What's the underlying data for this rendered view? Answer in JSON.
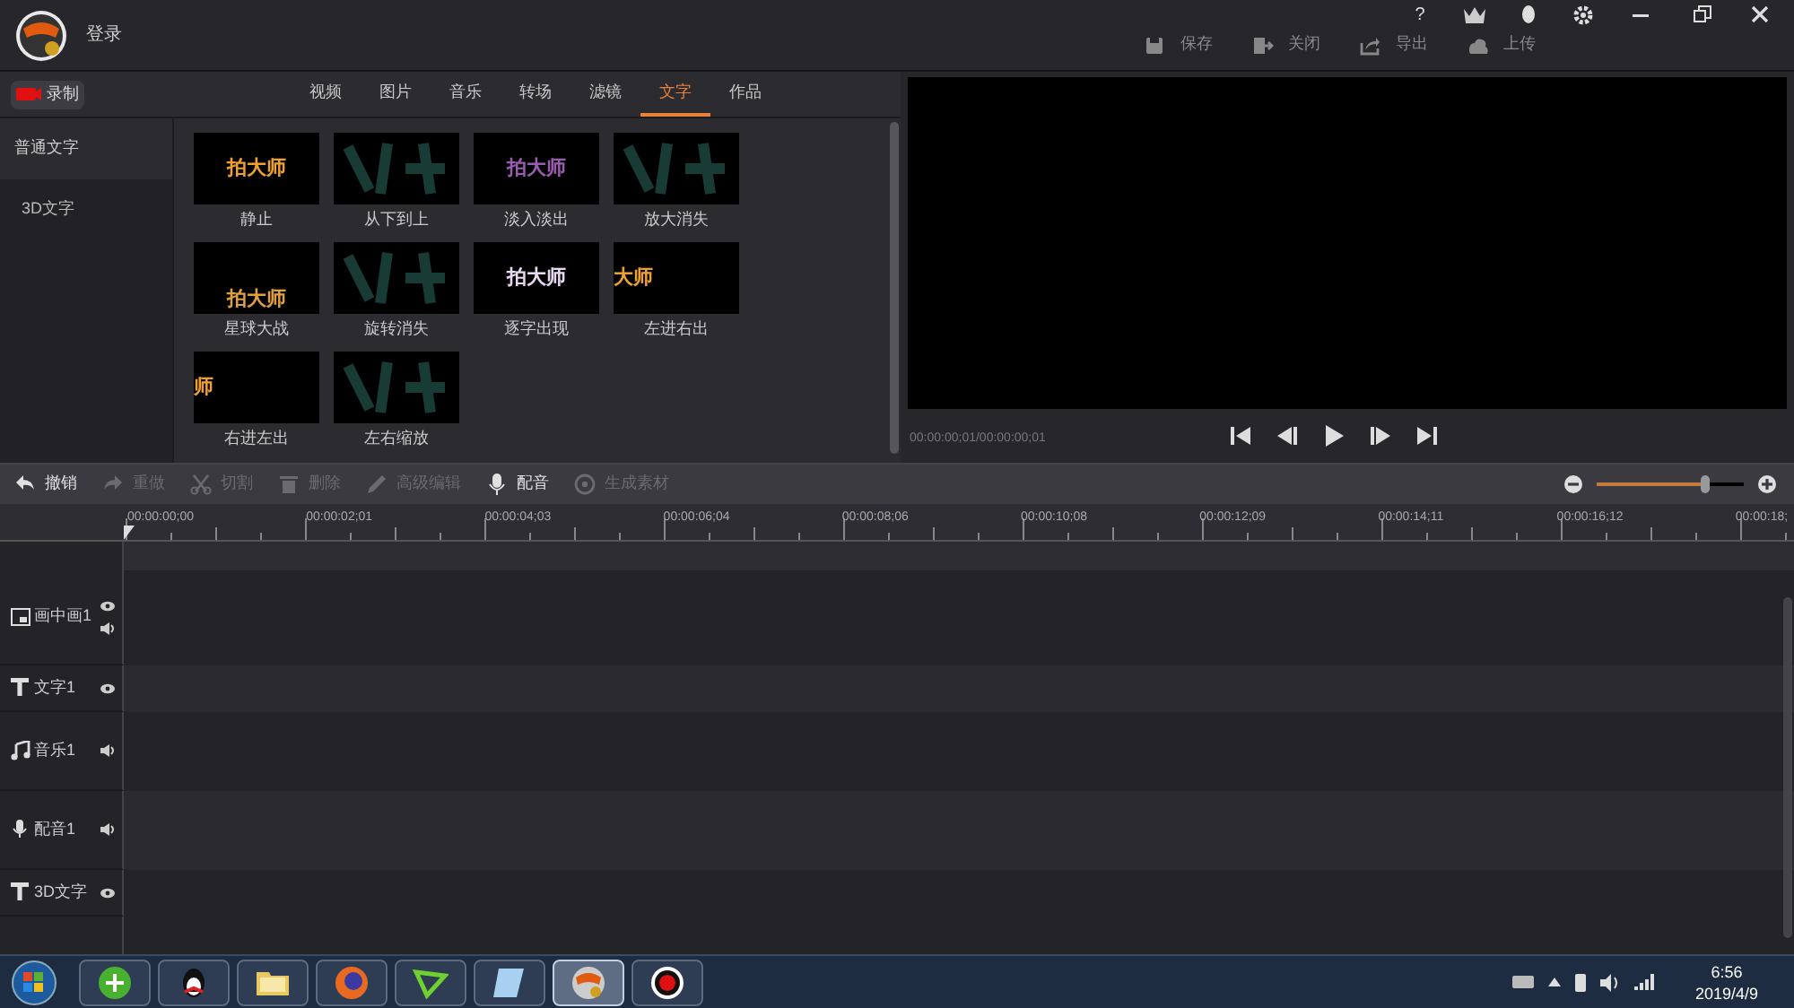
{
  "header": {
    "login": "登录",
    "window_controls": [
      {
        "kind": "help",
        "label": "?"
      },
      {
        "kind": "vip"
      },
      {
        "kind": "qq"
      },
      {
        "kind": "settings"
      },
      {
        "kind": "minimize"
      },
      {
        "kind": "restore"
      },
      {
        "kind": "close"
      }
    ],
    "actions": [
      {
        "kind": "save",
        "label": "保存"
      },
      {
        "kind": "exit",
        "label": "关闭"
      },
      {
        "kind": "export",
        "label": "导出"
      },
      {
        "kind": "upload",
        "label": "上传"
      }
    ]
  },
  "record_button": "录制",
  "tabs": [
    {
      "label": "视频",
      "selected": false
    },
    {
      "label": "图片",
      "selected": false
    },
    {
      "label": "音乐",
      "selected": false
    },
    {
      "label": "转场",
      "selected": false
    },
    {
      "label": "滤镜",
      "selected": false
    },
    {
      "label": "文字",
      "selected": true
    },
    {
      "label": "作品",
      "selected": false
    }
  ],
  "categories": [
    {
      "label": "普通文字",
      "selected": true
    },
    {
      "label": "3D文字",
      "selected": false
    }
  ],
  "effects": [
    {
      "label": "静止",
      "kind": "center",
      "text": "拍大师",
      "color": "#f0a030"
    },
    {
      "label": "从下到上",
      "kind": "abstract"
    },
    {
      "label": "淡入淡出",
      "kind": "center",
      "text": "拍大师",
      "color": "#9a5cb0"
    },
    {
      "label": "放大消失",
      "kind": "abstract"
    },
    {
      "label": "星球大战",
      "kind": "bottom",
      "text": "拍大师",
      "color": "#e0a040"
    },
    {
      "label": "旋转消失",
      "kind": "abstract"
    },
    {
      "label": "逐字出现",
      "kind": "center",
      "text": "拍大师",
      "color": "#e8d8f0"
    },
    {
      "label": "左进右出",
      "kind": "left",
      "text": "大师",
      "color": "#f0a030"
    },
    {
      "label": "右进左出",
      "kind": "left",
      "text": "师",
      "color": "#f0a030"
    },
    {
      "label": "左右缩放",
      "kind": "abstract"
    }
  ],
  "preview": {
    "time": "00:00:00;01/00:00:00;01"
  },
  "edit_toolbar": [
    {
      "kind": "undo",
      "label": "撤销",
      "disabled": false
    },
    {
      "kind": "redo",
      "label": "重做",
      "disabled": true
    },
    {
      "kind": "cut",
      "label": "切割",
      "disabled": true
    },
    {
      "kind": "delete",
      "label": "删除",
      "disabled": true
    },
    {
      "kind": "edit",
      "label": "高级编辑",
      "disabled": true
    },
    {
      "kind": "mic",
      "label": "配音",
      "disabled": false
    },
    {
      "kind": "material",
      "label": "生成素材",
      "disabled": true
    }
  ],
  "zoom": {
    "level": 0.73
  },
  "ruler": [
    "00:00:00;00",
    "00:00:02;01",
    "00:00:04;03",
    "00:00:06;04",
    "00:00:08;06",
    "00:00:10;08",
    "00:00:12;09",
    "00:00:14;11",
    "00:00:16;12",
    "00:00:18;"
  ],
  "tracks": [
    {
      "kind": "pip",
      "label": "画中画1",
      "eye": true,
      "sound": true
    },
    {
      "kind": "text",
      "label": "文字1",
      "eye": true,
      "sound": false
    },
    {
      "kind": "music",
      "label": "音乐1",
      "eye": false,
      "sound": true
    },
    {
      "kind": "voice",
      "label": "配音1",
      "eye": false,
      "sound": true
    },
    {
      "kind": "text",
      "label": "3D文字",
      "eye": true,
      "sound": false
    }
  ],
  "taskbar": {
    "apps": [
      {
        "kind": "browser",
        "selected": false
      },
      {
        "kind": "penguin",
        "selected": false
      },
      {
        "kind": "folder",
        "selected": false
      },
      {
        "kind": "firefox",
        "selected": false
      },
      {
        "kind": "player",
        "selected": false
      },
      {
        "kind": "notepad",
        "selected": false
      },
      {
        "kind": "app",
        "selected": true
      },
      {
        "kind": "record",
        "selected": false
      }
    ],
    "time": "6:56",
    "date": "2019/4/9"
  }
}
